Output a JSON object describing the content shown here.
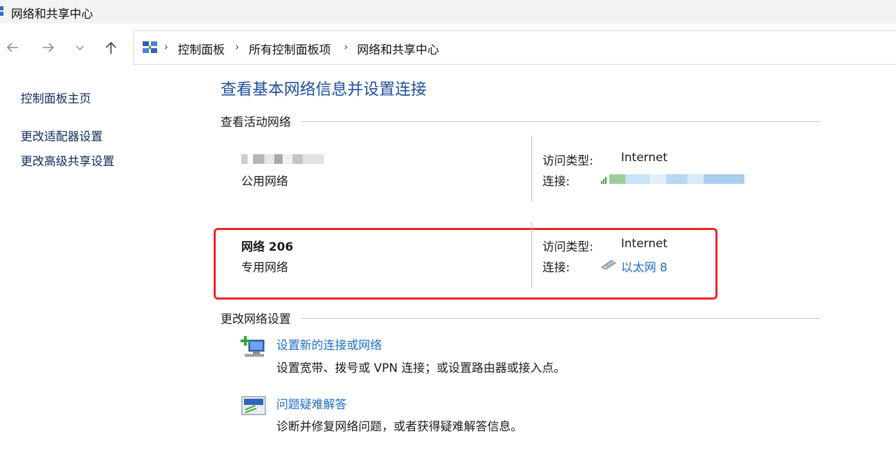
{
  "window": {
    "title": "网络和共享中心"
  },
  "nav": {
    "back_glyph": "←",
    "forward_glyph": "→",
    "recent_glyph": "⌄",
    "up_glyph": "↑"
  },
  "breadcrumb": {
    "separator": "›",
    "items": [
      "控制面板",
      "所有控制面板项",
      "网络和共享中心"
    ]
  },
  "sidebar": {
    "items": [
      "控制面板主页",
      "更改适配器设置",
      "更改高级共享设置"
    ]
  },
  "main": {
    "heading": "查看基本网络信息并设置连接",
    "active_networks_label": "查看活动网络",
    "networks": [
      {
        "name": "",
        "category": "公用网络",
        "access_label": "访问类型:",
        "access_value": "Internet",
        "conn_label": "连接:",
        "conn_value": ""
      },
      {
        "name": "网络 206",
        "category": "专用网络",
        "access_label": "访问类型:",
        "access_value": "Internet",
        "conn_label": "连接:",
        "conn_value": "以太网 8"
      }
    ],
    "change_settings_label": "更改网络设置",
    "tasks": [
      {
        "title": "设置新的连接或网络",
        "desc": "设置宽带、拨号或 VPN 连接；或设置路由器或接入点。"
      },
      {
        "title": "问题疑难解答",
        "desc": "诊断并修复网络问题，或者获得疑难解答信息。"
      }
    ]
  },
  "colors": {
    "heading": "#1e4e9b",
    "link": "#1e6dc8",
    "highlight_box": "#ee2222"
  }
}
